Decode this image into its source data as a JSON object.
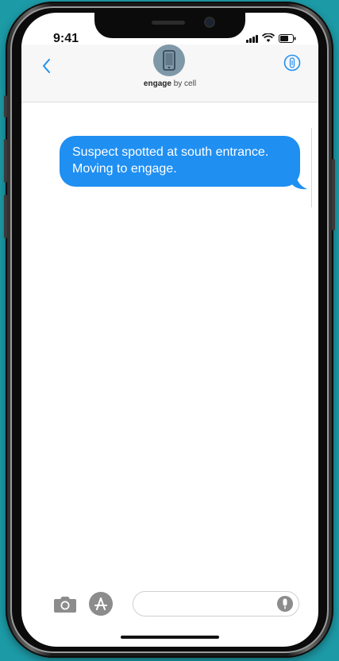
{
  "status_bar": {
    "time": "9:41"
  },
  "header": {
    "contact_name_bold": "engage",
    "contact_name_rest": " by cell",
    "back_icon": "chevron-left-icon",
    "info_icon": "info-icon",
    "avatar_icon": "phone-icon"
  },
  "messages": [
    {
      "direction": "outgoing",
      "text": "Suspect spotted at south entrance. Moving to engage."
    }
  ],
  "composer": {
    "placeholder": "",
    "camera_icon": "camera-icon",
    "apps_icon": "app-store-icon",
    "mic_icon": "microphone-icon"
  },
  "colors": {
    "background": "#1c9aa6",
    "bubble": "#1f8ff2",
    "accent": "#1f8ff2",
    "avatar": "#7f98a8"
  }
}
